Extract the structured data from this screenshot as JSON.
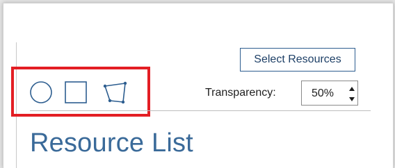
{
  "toolbar": {
    "select_resources_label": "Select Resources",
    "shape_tools": [
      {
        "name": "circle",
        "icon": "circle-icon"
      },
      {
        "name": "rectangle",
        "icon": "rectangle-icon"
      },
      {
        "name": "polygon",
        "icon": "polygon-icon"
      }
    ],
    "transparency": {
      "label": "Transparency:",
      "value": "50%"
    }
  },
  "main": {
    "section_title": "Resource List"
  },
  "colors": {
    "accent": "#2c5d8f",
    "title": "#3a6a99",
    "highlight": "#e31e24"
  }
}
